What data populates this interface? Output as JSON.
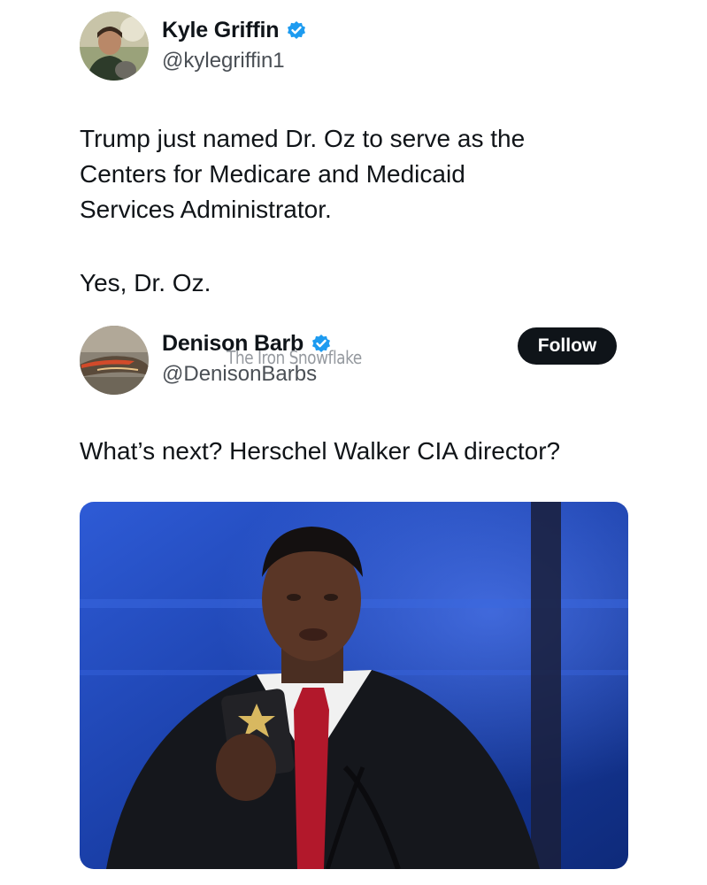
{
  "tweet": {
    "author_name": "Kyle Griffin",
    "author_handle": "@kylegriffin1",
    "text": "Trump just named Dr. Oz to serve as the\nCenters for Medicare and Medicaid\nServices Administrator.",
    "text2": "Yes, Dr. Oz."
  },
  "quoted": {
    "author_name": "Denison Barb",
    "author_handle": "@DenisonBarbs",
    "follow_label": "Follow",
    "text": "What’s next? Herschel Walker CIA director?"
  },
  "watermark": "The Iron Snowflake",
  "colors": {
    "verified_blue": "#1d9bf0",
    "follow_bg": "#0f1419",
    "media_bg": "#1a3fa8"
  }
}
